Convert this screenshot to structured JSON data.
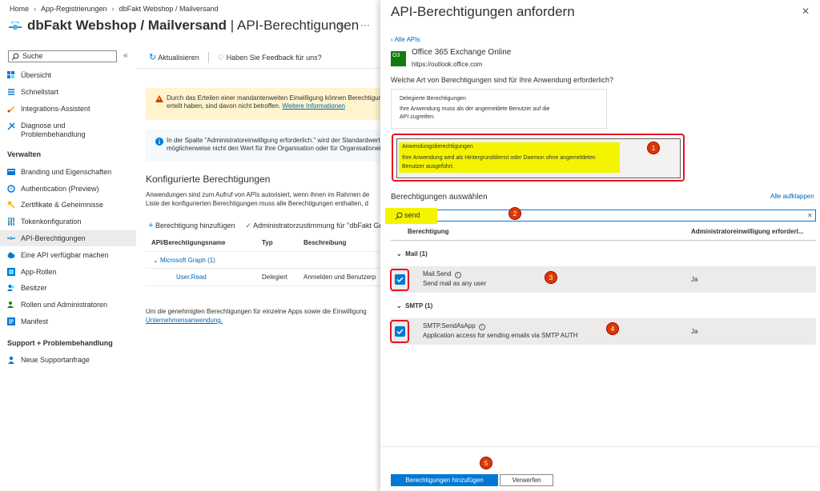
{
  "breadcrumb": [
    "Home",
    "App-Registrierungen",
    "dbFakt Webshop / Mailversand"
  ],
  "page": {
    "title_bold": "dbFakt Webshop / Mailversand",
    "title_rest": " | API-Berechtigungen"
  },
  "sidebar": {
    "search_placeholder": "Suche",
    "collapse": "«",
    "items_top": [
      {
        "label": "Übersicht",
        "icon": "overview-icon"
      },
      {
        "label": "Schnellstart",
        "icon": "quickstart-icon"
      },
      {
        "label": "Integrations-Assistent",
        "icon": "rocket-icon"
      },
      {
        "label": "Diagnose und",
        "label2": "Problembehandlung",
        "icon": "wrench-icon"
      }
    ],
    "section_manage": "Verwalten",
    "items_manage": [
      {
        "label": "Branding und Eigenschaften",
        "icon": "branding-icon"
      },
      {
        "label": "Authentication (Preview)",
        "icon": "authentication-icon"
      },
      {
        "label": "Zertifikate & Geheimnisse",
        "icon": "key-icon"
      },
      {
        "label": "Tokenkonfiguration",
        "icon": "token-icon"
      },
      {
        "label": "API-Berechtigungen",
        "icon": "api-permissions-icon"
      },
      {
        "label": "Eine API verfügbar machen",
        "icon": "cloud-icon"
      },
      {
        "label": "App-Rollen",
        "icon": "app-roles-icon"
      },
      {
        "label": "Besitzer",
        "icon": "owners-icon"
      },
      {
        "label": "Rollen und Administratoren",
        "icon": "roles-icon"
      },
      {
        "label": "Manifest",
        "icon": "manifest-icon"
      }
    ],
    "section_support": "Support + Problembehandlung",
    "items_support": [
      {
        "label": "Neue Supportanfrage",
        "icon": "support-icon"
      }
    ]
  },
  "toolbar": {
    "refresh": "Aktualisieren",
    "feedback": "Haben Sie Feedback für uns?"
  },
  "warning": {
    "line1": "Durch das Erteilen einer mandantenweiten Einwilligung können Berechtigung",
    "line2": "erteilt haben, sind davon nicht betroffen. ",
    "link": "Weitere Informationen"
  },
  "info": {
    "line1": "In der Spalte \"Administratoreinwilligung erforderlich.\" wird der Standardwert",
    "line2": "möglicherweise nicht den Wert für Ihre Organisation oder für Organisationen,"
  },
  "configured": {
    "heading": "Konfigurierte Berechtigungen",
    "desc1": "Anwendungen sind zum Aufruf von APIs autorisiert, wenn ihnen im Rahmen de",
    "desc2": "Liste der konfigurierten Berechtigungen muss alle Berechtigungen enthalten, d",
    "add_permission": "Berechtigung hinzufügen",
    "grant_consent": "Administratorzustimmung für \"dbFakt Gr",
    "columns": [
      "API/Berechtigungsname",
      "Typ",
      "Beschreibung"
    ],
    "group": "Microsoft Graph (1)",
    "rows": [
      {
        "name": "User.Read",
        "type": "Delegiert",
        "desc": "Anmelden und Benutzerp"
      }
    ],
    "footnote1": "Um die genehmigten Berechtigungen für einzelne Apps sowie die Einwilligung",
    "footnote_link": "Unternehmensanwendung."
  },
  "blade": {
    "title": "API-Berechtigungen anfordern",
    "close": "✕",
    "back": "‹ Alle APIs",
    "api_icon_text": "O3",
    "api_name": "Office 365 Exchange Online",
    "api_url": "https://outlook.office.com",
    "question": "Welche Art von Berechtigungen sind für Ihre Anwendung erforderlich?",
    "delegated": {
      "title": "Delegierte Berechtigungen",
      "desc1": "Ihre Anwendung muss als der angemeldete Benutzer auf die",
      "desc2": "API zugreifen."
    },
    "application": {
      "title": "Anwendungsberechtigungen",
      "desc1": "Ihre Anwendung wird als Hintergrunddienst oder Daemon ohne angemeldeten",
      "desc2": "Benutzer ausgeführt."
    },
    "select_label": "Berechtigungen auswählen",
    "expand_all": "Alle aufklappen",
    "filter_value": "send",
    "col_permission": "Berechtigung",
    "col_admin": "Administratoreinwilligung erforderl...",
    "groups": [
      {
        "name": "Mail (1)",
        "perm": "Mail.Send",
        "desc": "Send mail as any user",
        "admin": "Ja",
        "checked": true
      },
      {
        "name": "SMTP (1)",
        "perm": "SMTP.SendAsApp",
        "desc": "Application access for sending emails via SMTP AUTH",
        "admin": "Ja",
        "checked": true
      }
    ],
    "add_button": "Berechtigungen hinzufügen",
    "discard_button": "Verwerfen"
  },
  "annotations": [
    "1",
    "2",
    "3",
    "4",
    "5"
  ],
  "colors": {
    "accent": "#0078d4",
    "highlight": "#f4f400",
    "annotation": "#d83b01",
    "annotation_border": "#e81123"
  }
}
